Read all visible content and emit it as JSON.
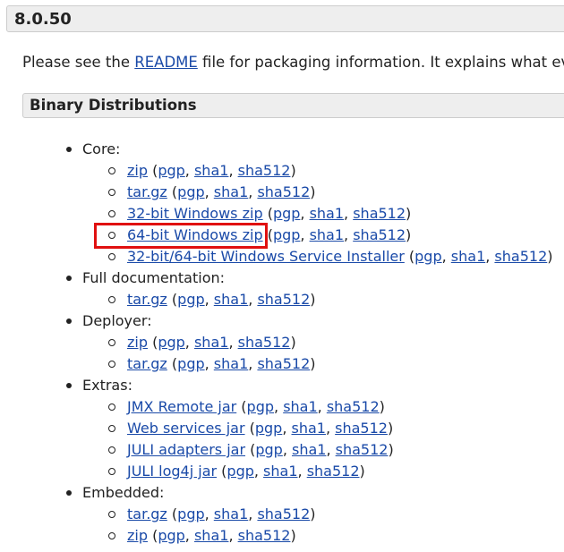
{
  "version": "8.0.50",
  "intro": {
    "prefix": "Please see the ",
    "link": "README",
    "suffix": " file for packaging information. It explains what eve"
  },
  "section_title": "Binary Distributions",
  "categories": [
    {
      "label": "Core:",
      "items": [
        {
          "main": "zip",
          "sigs": [
            "pgp",
            "sha1",
            "sha512"
          ]
        },
        {
          "main": "tar.gz",
          "sigs": [
            "pgp",
            "sha1",
            "sha512"
          ]
        },
        {
          "main": "32-bit Windows zip",
          "sigs": [
            "pgp",
            "sha1",
            "sha512"
          ]
        },
        {
          "main": "64-bit Windows zip",
          "sigs": [
            "pgp",
            "sha1",
            "sha512"
          ],
          "highlighted": true
        },
        {
          "main": "32-bit/64-bit Windows Service Installer",
          "sigs": [
            "pgp",
            "sha1",
            "sha512"
          ]
        }
      ]
    },
    {
      "label": "Full documentation:",
      "items": [
        {
          "main": "tar.gz",
          "sigs": [
            "pgp",
            "sha1",
            "sha512"
          ]
        }
      ]
    },
    {
      "label": "Deployer:",
      "items": [
        {
          "main": "zip",
          "sigs": [
            "pgp",
            "sha1",
            "sha512"
          ]
        },
        {
          "main": "tar.gz",
          "sigs": [
            "pgp",
            "sha1",
            "sha512"
          ]
        }
      ]
    },
    {
      "label": "Extras:",
      "items": [
        {
          "main": "JMX Remote jar",
          "sigs": [
            "pgp",
            "sha1",
            "sha512"
          ]
        },
        {
          "main": "Web services jar",
          "sigs": [
            "pgp",
            "sha1",
            "sha512"
          ]
        },
        {
          "main": "JULI adapters jar",
          "sigs": [
            "pgp",
            "sha1",
            "sha512"
          ]
        },
        {
          "main": "JULI log4j jar",
          "sigs": [
            "pgp",
            "sha1",
            "sha512"
          ]
        }
      ]
    },
    {
      "label": "Embedded:",
      "items": [
        {
          "main": "tar.gz",
          "sigs": [
            "pgp",
            "sha1",
            "sha512"
          ]
        },
        {
          "main": "zip",
          "sigs": [
            "pgp",
            "sha1",
            "sha512"
          ]
        }
      ]
    }
  ],
  "colors": {
    "link": "#1a4aa8",
    "highlight_border": "#e01010",
    "header_bg": "#eeeeee"
  }
}
